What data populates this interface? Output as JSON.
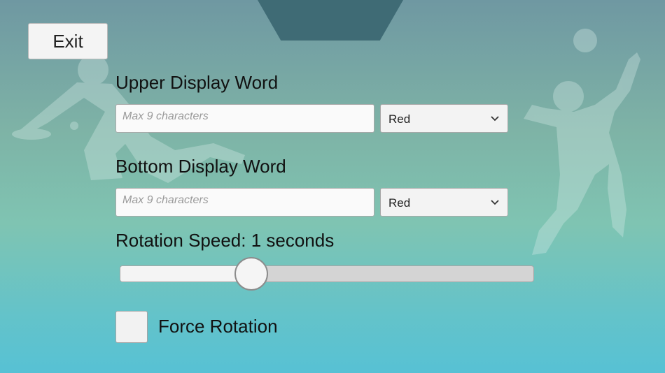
{
  "exit_button": {
    "label": "Exit"
  },
  "upper_word": {
    "label": "Upper Display Word",
    "input_value": "",
    "input_placeholder": "Max 9 characters",
    "color_selected": "Red"
  },
  "bottom_word": {
    "label": "Bottom Display Word",
    "input_value": "",
    "input_placeholder": "Max 9 characters",
    "color_selected": "Red"
  },
  "rotation_speed": {
    "label": "Rotation Speed: 1 seconds",
    "slider_fraction": 0.32
  },
  "force_rotation": {
    "label": "Force Rotation",
    "checked": false
  },
  "icons": {
    "dropdown": "chevron-down-icon",
    "background": "volleyball-players-silhouette"
  },
  "colors": {
    "background_top": "#6f98a2",
    "background_bottom": "#57c1d4",
    "top_tab": "#3f6b75"
  }
}
